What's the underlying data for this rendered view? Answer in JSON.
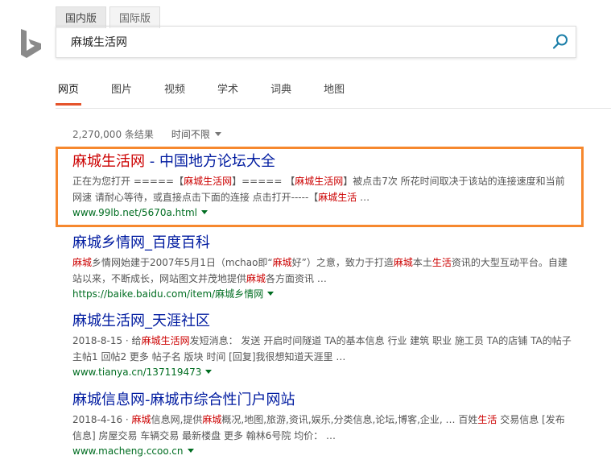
{
  "region_tabs": [
    "国内版",
    "国际版"
  ],
  "search": {
    "value": "麻城生活网"
  },
  "nav": [
    "网页",
    "图片",
    "视频",
    "学术",
    "词典",
    "地图"
  ],
  "meta": {
    "count": "2,270,000 条结果",
    "time_filter": "时间不限"
  },
  "results": [
    {
      "title": [
        {
          "t": "麻城生活网",
          "h": true
        },
        {
          "t": " - 中国地方论坛大全",
          "h": false
        }
      ],
      "snippet": [
        {
          "t": "正在为您打开 =====【",
          "h": false
        },
        {
          "t": "麻城生活网",
          "h": true
        },
        {
          "t": "】===== 【",
          "h": false
        },
        {
          "t": "麻城生活网",
          "h": true
        },
        {
          "t": "】被点击7次 所花时间取决于该站的连接速度和当前网速 请耐心等待，或直接点击下面的连接 点击打开-----【",
          "h": false
        },
        {
          "t": "麻城生活",
          "h": true
        },
        {
          "t": " …",
          "h": false
        }
      ],
      "url": "www.99lb.net/5670a.html"
    },
    {
      "title": [
        {
          "t": "麻城乡情网_百度百科",
          "h": false
        }
      ],
      "snippet": [
        {
          "t": "麻城",
          "h": true
        },
        {
          "t": "乡情网始建于2007年5月1日（mchao即“",
          "h": false
        },
        {
          "t": "麻城",
          "h": true
        },
        {
          "t": "好”）之意，致力于打造",
          "h": false
        },
        {
          "t": "麻城",
          "h": true
        },
        {
          "t": "本土",
          "h": false
        },
        {
          "t": "生活",
          "h": true
        },
        {
          "t": "资讯的大型互动平台。自建站以来，不断成长，网站图文并茂地提供",
          "h": false
        },
        {
          "t": "麻城",
          "h": true
        },
        {
          "t": "各方面资讯 …",
          "h": false
        }
      ],
      "url": "https://baike.baidu.com/item/麻城乡情网"
    },
    {
      "title": [
        {
          "t": "麻城生活网_天涯社区",
          "h": false
        }
      ],
      "snippet": [
        {
          "t": "2018-8-15 · 给",
          "h": false
        },
        {
          "t": "麻城生活网",
          "h": true
        },
        {
          "t": "发短消息： 发送 开启时间隧道 TA的基本信息 行业 建筑 职业 施工员 TA的店铺 TA的帖子 主帖1 回帖2 更多 帖子名 版块 时间 [回复]我很想知道天涯里 …",
          "h": false
        }
      ],
      "url": "www.tianya.cn/137119473"
    },
    {
      "title": [
        {
          "t": "麻城信息网-麻城市综合性门户网站",
          "h": false
        }
      ],
      "snippet": [
        {
          "t": "2018-4-16 · ",
          "h": false
        },
        {
          "t": "麻城",
          "h": true
        },
        {
          "t": "信息网,提供",
          "h": false
        },
        {
          "t": "麻城",
          "h": true
        },
        {
          "t": "概况,地图,旅游,资讯,娱乐,分类信息,论坛,博客,企业, … 百姓",
          "h": false
        },
        {
          "t": "生活",
          "h": true
        },
        {
          "t": " 交易信息 [发布信息] 房屋交易 车辆交易 最新楼盘 更多 翰林6号院 均价： …",
          "h": false
        }
      ],
      "url": "www.macheng.ccoo.cn"
    }
  ]
}
